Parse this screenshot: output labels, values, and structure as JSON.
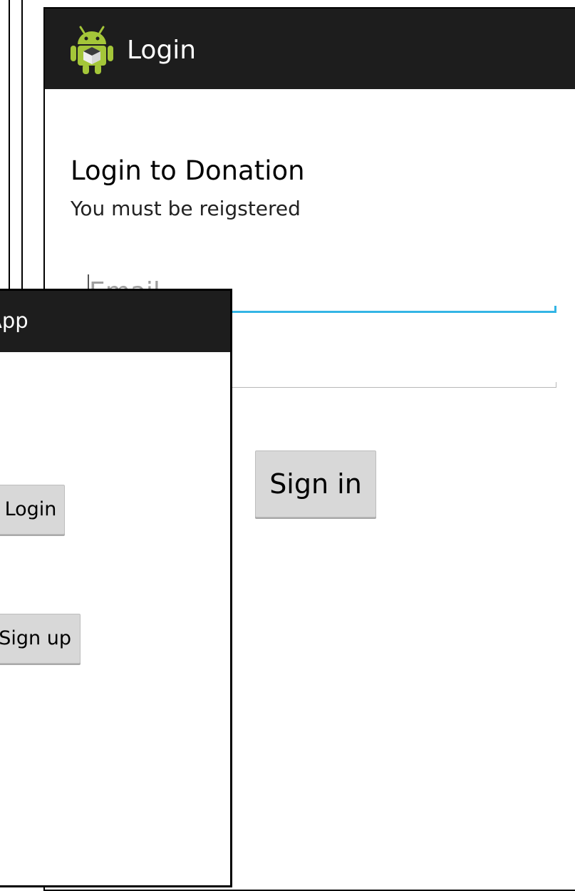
{
  "login_screen": {
    "action_bar": {
      "title": "Login",
      "icon": "android-icon"
    },
    "heading": "Login to Donation",
    "subheading": "You must be reigstered",
    "email_field": {
      "placeholder": "Email",
      "value": ""
    },
    "password_field": {
      "placeholder": "",
      "value": ""
    },
    "signin_button": "Sign in"
  },
  "main_screen": {
    "action_bar": {
      "title": "App"
    },
    "login_button": "Login",
    "signup_button": "Sign up"
  },
  "colors": {
    "action_bar": "#1d1d1d",
    "focus_accent": "#33b5e5",
    "button": "#d8d8d8"
  }
}
